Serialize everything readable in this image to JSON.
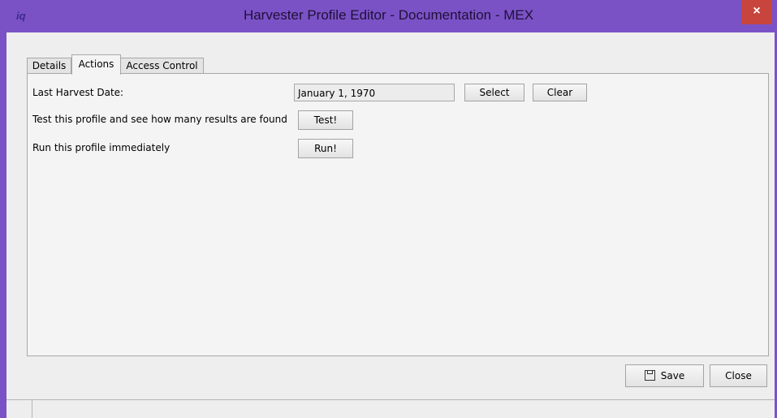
{
  "window": {
    "title": "Harvester Profile Editor - Documentation - MEX",
    "close_glyph": "×",
    "app_icon": "iq"
  },
  "tabs": [
    {
      "label": "Details",
      "active": false
    },
    {
      "label": "Actions",
      "active": true
    },
    {
      "label": "Access Control",
      "active": false
    }
  ],
  "actions": {
    "last_harvest_label": "Last Harvest Date:",
    "last_harvest_value": "January 1, 1970",
    "select_label": "Select",
    "clear_label": "Clear",
    "test_text": "Test this profile and see how many results are found",
    "test_button": "Test!",
    "run_text": "Run this profile immediately",
    "run_button": "Run!"
  },
  "footer": {
    "save_label": "Save",
    "close_label": "Close"
  },
  "icons": {
    "save": "floppy-disk-icon",
    "window_close": "close-icon"
  },
  "colors": {
    "titlebar": "#7b52c6",
    "close_button": "#c7453c",
    "panel": "#f4f4f4"
  }
}
